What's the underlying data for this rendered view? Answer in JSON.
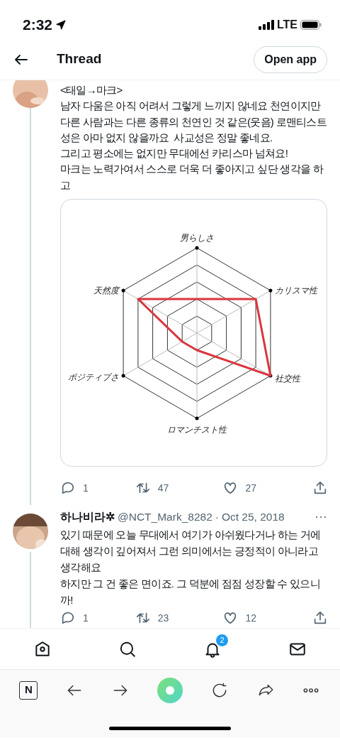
{
  "status_bar": {
    "time": "2:32",
    "network": "LTE"
  },
  "header": {
    "title": "Thread",
    "button": "Open app"
  },
  "tweets": [
    {
      "text": "<태일→마크>\n남자 다움은 아직 어려서 그렇게 느끼지 않네요 천연이지만 다른 사람과는 다른 종류의 천연인 것 같은(웃음) 로맨티스트성은 아마 없지 않을까요  사교성은 정말 좋네요.\n그리고 평소에는 없지만 무대에선 카리스마 넘쳐요!\n마크는 노력가여서 스스로 더욱 더 좋아지고 싶단 생각을 하고",
      "image": {
        "axis_labels": [
          "男らしさ",
          "天然度",
          "カリスマ性",
          "ポジティブさ",
          "社交性",
          "ロマンチスト性"
        ]
      },
      "replies": "1",
      "retweets": "47",
      "likes": "27"
    },
    {
      "name": "하나비라✲",
      "handle": "@NCT_Mark_8282",
      "separator": "·",
      "date": "Oct 25, 2018",
      "text": "있기 때문에 오늘 무대에서 여기가 아쉬웠다거나 하는 거에 대해 생각이 깊어져서 그런 의미에서는 긍정적이 아니라고 생각해요\n하지만 그 건 좋은 면이죠. 그 덕분에 점점 성장할 수 있으니까!",
      "replies": "1",
      "retweets": "23",
      "likes": "12"
    }
  ],
  "tab_bar": {
    "notification_badge": "2"
  },
  "browser_bar": {
    "logo": "N"
  }
}
